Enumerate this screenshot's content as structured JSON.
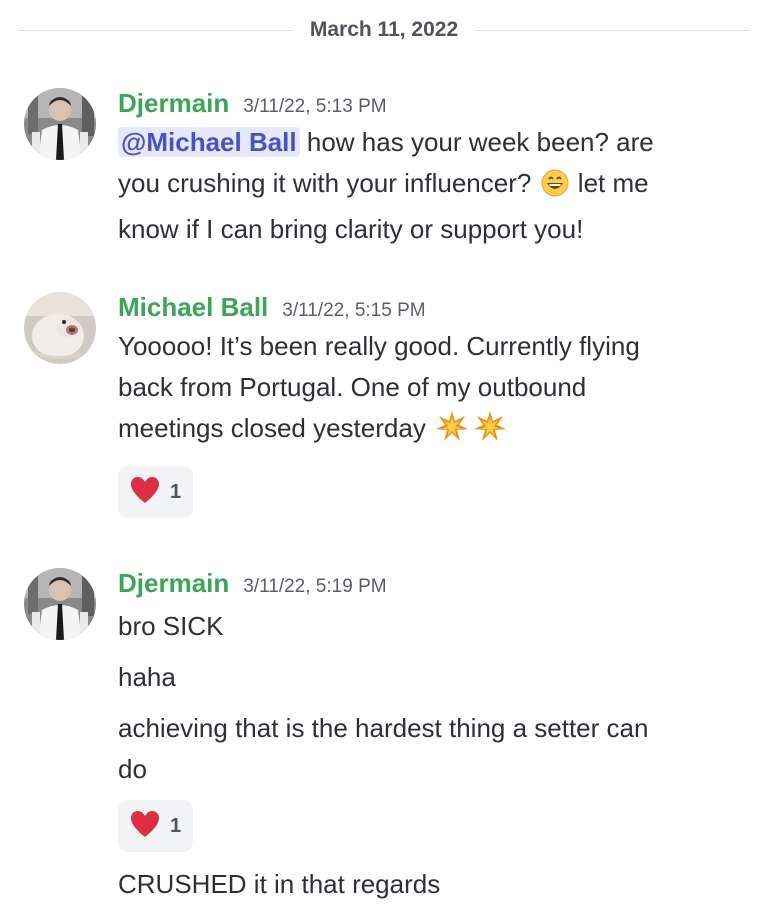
{
  "date_divider": "March 11, 2022",
  "messages": [
    {
      "author": "Djermain",
      "timestamp": "3/11/22, 5:13 PM",
      "mention": "@Michael Ball",
      "line1_rest": "how has your week been? are",
      "line2": "you crushing it with your influencer?",
      "line2_end": "let me",
      "line3": "know if I can bring clarity or support you!"
    },
    {
      "author": "Michael Ball",
      "timestamp": "3/11/22, 5:15 PM",
      "line1": "Yooooo! It’s been really good. Currently flying",
      "line2": "back from Portugal. One of my outbound",
      "line3": "meetings closed yesterday",
      "reaction": {
        "emoji": "heart-emoji",
        "count": "1"
      }
    },
    {
      "author": "Djermain",
      "timestamp": "3/11/22, 5:19 PM",
      "lines": [
        "bro SICK",
        "haha",
        "achieving that is the hardest thing a setter can",
        "do"
      ],
      "reaction": {
        "emoji": "heart-emoji",
        "count": "1"
      },
      "last_line": "CRUSHED it in that regards"
    }
  ],
  "colors": {
    "author": "#3aa656",
    "mention_bg": "#e6e8fd",
    "mention_text": "#4752c4",
    "reaction_bg": "#f2f3f5",
    "heart": "#dd2e44"
  }
}
